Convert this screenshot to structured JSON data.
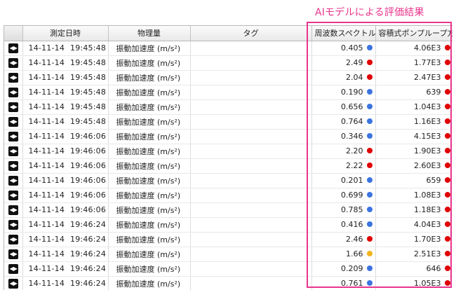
{
  "annotation": "AIモデルによる評価結果",
  "colors": {
    "annotation": "#e8348c",
    "blue": "#3b74e0",
    "red": "#e00000",
    "yellow": "#f0b41e"
  },
  "columns": [
    "",
    "測定日時",
    "物理量",
    "タグ",
    "周波数スペクトル",
    "容積式ポンプループ方向"
  ],
  "rows": [
    {
      "date": "14-11-14",
      "time": "19:45:48",
      "quantity": "振動加速度 (m/s²)",
      "tag": "",
      "spectrum": "0.405",
      "spectrum_status": "blue",
      "pump": "4.06E3",
      "pump_status": "red"
    },
    {
      "date": "14-11-14",
      "time": "19:45:48",
      "quantity": "振動加速度 (m/s²)",
      "tag": "",
      "spectrum": "2.49",
      "spectrum_status": "red",
      "pump": "1.77E3",
      "pump_status": "red"
    },
    {
      "date": "14-11-14",
      "time": "19:45:48",
      "quantity": "振動加速度 (m/s²)",
      "tag": "",
      "spectrum": "2.04",
      "spectrum_status": "red",
      "pump": "2.47E3",
      "pump_status": "red"
    },
    {
      "date": "14-11-14",
      "time": "19:45:48",
      "quantity": "振動加速度 (m/s²)",
      "tag": "",
      "spectrum": "0.190",
      "spectrum_status": "blue",
      "pump": "639",
      "pump_status": "red"
    },
    {
      "date": "14-11-14",
      "time": "19:45:48",
      "quantity": "振動加速度 (m/s²)",
      "tag": "",
      "spectrum": "0.656",
      "spectrum_status": "blue",
      "pump": "1.04E3",
      "pump_status": "red"
    },
    {
      "date": "14-11-14",
      "time": "19:45:48",
      "quantity": "振動加速度 (m/s²)",
      "tag": "",
      "spectrum": "0.764",
      "spectrum_status": "blue",
      "pump": "1.16E3",
      "pump_status": "red"
    },
    {
      "date": "14-11-14",
      "time": "19:46:06",
      "quantity": "振動加速度 (m/s²)",
      "tag": "",
      "spectrum": "0.346",
      "spectrum_status": "blue",
      "pump": "4.15E3",
      "pump_status": "red"
    },
    {
      "date": "14-11-14",
      "time": "19:46:06",
      "quantity": "振動加速度 (m/s²)",
      "tag": "",
      "spectrum": "2.20",
      "spectrum_status": "red",
      "pump": "1.90E3",
      "pump_status": "red"
    },
    {
      "date": "14-11-14",
      "time": "19:46:06",
      "quantity": "振動加速度 (m/s²)",
      "tag": "",
      "spectrum": "2.22",
      "spectrum_status": "red",
      "pump": "2.60E3",
      "pump_status": "red"
    },
    {
      "date": "14-11-14",
      "time": "19:46:06",
      "quantity": "振動加速度 (m/s²)",
      "tag": "",
      "spectrum": "0.201",
      "spectrum_status": "blue",
      "pump": "659",
      "pump_status": "red"
    },
    {
      "date": "14-11-14",
      "time": "19:46:06",
      "quantity": "振動加速度 (m/s²)",
      "tag": "",
      "spectrum": "0.699",
      "spectrum_status": "blue",
      "pump": "1.08E3",
      "pump_status": "red"
    },
    {
      "date": "14-11-14",
      "time": "19:46:06",
      "quantity": "振動加速度 (m/s²)",
      "tag": "",
      "spectrum": "0.785",
      "spectrum_status": "blue",
      "pump": "1.18E3",
      "pump_status": "red"
    },
    {
      "date": "14-11-14",
      "time": "19:46:24",
      "quantity": "振動加速度 (m/s²)",
      "tag": "",
      "spectrum": "0.416",
      "spectrum_status": "blue",
      "pump": "4.04E3",
      "pump_status": "red"
    },
    {
      "date": "14-11-14",
      "time": "19:46:24",
      "quantity": "振動加速度 (m/s²)",
      "tag": "",
      "spectrum": "2.46",
      "spectrum_status": "red",
      "pump": "1.70E3",
      "pump_status": "red"
    },
    {
      "date": "14-11-14",
      "time": "19:46:24",
      "quantity": "振動加速度 (m/s²)",
      "tag": "",
      "spectrum": "1.66",
      "spectrum_status": "yellow",
      "pump": "2.51E3",
      "pump_status": "red"
    },
    {
      "date": "14-11-14",
      "time": "19:46:24",
      "quantity": "振動加速度 (m/s²)",
      "tag": "",
      "spectrum": "0.209",
      "spectrum_status": "blue",
      "pump": "646",
      "pump_status": "red"
    },
    {
      "date": "14-11-14",
      "time": "19:46:24",
      "quantity": "振動加速度 (m/s²)",
      "tag": "",
      "spectrum": "0.761",
      "spectrum_status": "blue",
      "pump": "1.05E3",
      "pump_status": "red"
    }
  ]
}
